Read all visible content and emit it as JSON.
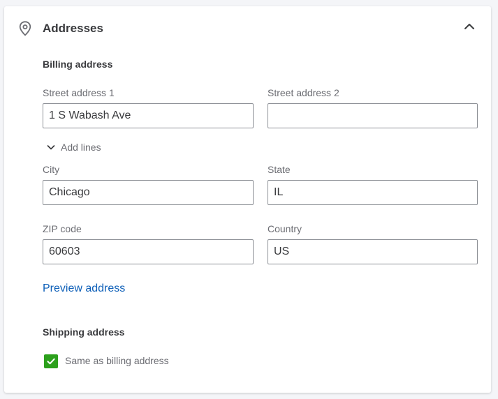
{
  "section": {
    "title": "Addresses",
    "icon": "map-pin-icon",
    "collapse_icon": "chevron-up-icon"
  },
  "billing": {
    "heading": "Billing address",
    "street1": {
      "label": "Street address 1",
      "value": "1 S Wabash Ave"
    },
    "street2": {
      "label": "Street address 2",
      "value": ""
    },
    "add_lines": {
      "label": "Add lines",
      "icon": "chevron-down-icon"
    },
    "city": {
      "label": "City",
      "value": "Chicago"
    },
    "state": {
      "label": "State",
      "value": "IL"
    },
    "zip": {
      "label": "ZIP code",
      "value": "60603"
    },
    "country": {
      "label": "Country",
      "value": "US"
    },
    "preview_link": "Preview address"
  },
  "shipping": {
    "heading": "Shipping address",
    "same_as_billing": {
      "label": "Same as billing address",
      "checked": true
    }
  },
  "colors": {
    "accent_green": "#2ca01c",
    "link_blue": "#0d5fb8",
    "text": "#393a3d",
    "muted": "#6b6c72",
    "border": "#8d9096"
  }
}
